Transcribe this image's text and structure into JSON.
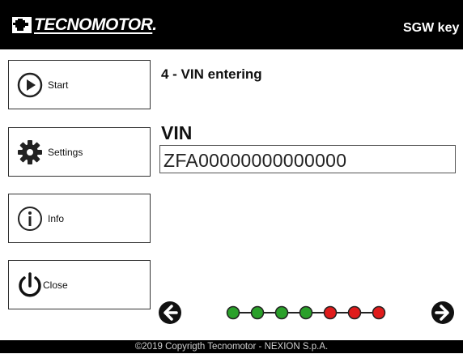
{
  "header": {
    "logo_text": "TECNOMOTOR",
    "logo_dot": ".",
    "title": "SGW key"
  },
  "sidebar": {
    "items": [
      {
        "label": "Start",
        "icon": "play-icon"
      },
      {
        "label": "Settings",
        "icon": "gear-icon"
      },
      {
        "label": "Info",
        "icon": "info-icon"
      },
      {
        "label": "Close",
        "icon": "power-icon"
      }
    ]
  },
  "main": {
    "step_title": "4 - VIN entering",
    "vin_label": "VIN",
    "vin_value": "ZFA00000000000000"
  },
  "navigation": {
    "back_icon": "arrow-left-icon",
    "next_icon": "arrow-right-icon",
    "steps": [
      {
        "status": "done",
        "color": "#2aa02a"
      },
      {
        "status": "done",
        "color": "#2aa02a"
      },
      {
        "status": "done",
        "color": "#2aa02a"
      },
      {
        "status": "current",
        "color": "#2aa02a"
      },
      {
        "status": "pending",
        "color": "#e01b1b"
      },
      {
        "status": "pending",
        "color": "#e01b1b"
      },
      {
        "status": "pending",
        "color": "#e01b1b"
      }
    ]
  },
  "footer": {
    "copyright": "©2019 Copyrigth Tecnomotor - NEXION S.p.A."
  }
}
